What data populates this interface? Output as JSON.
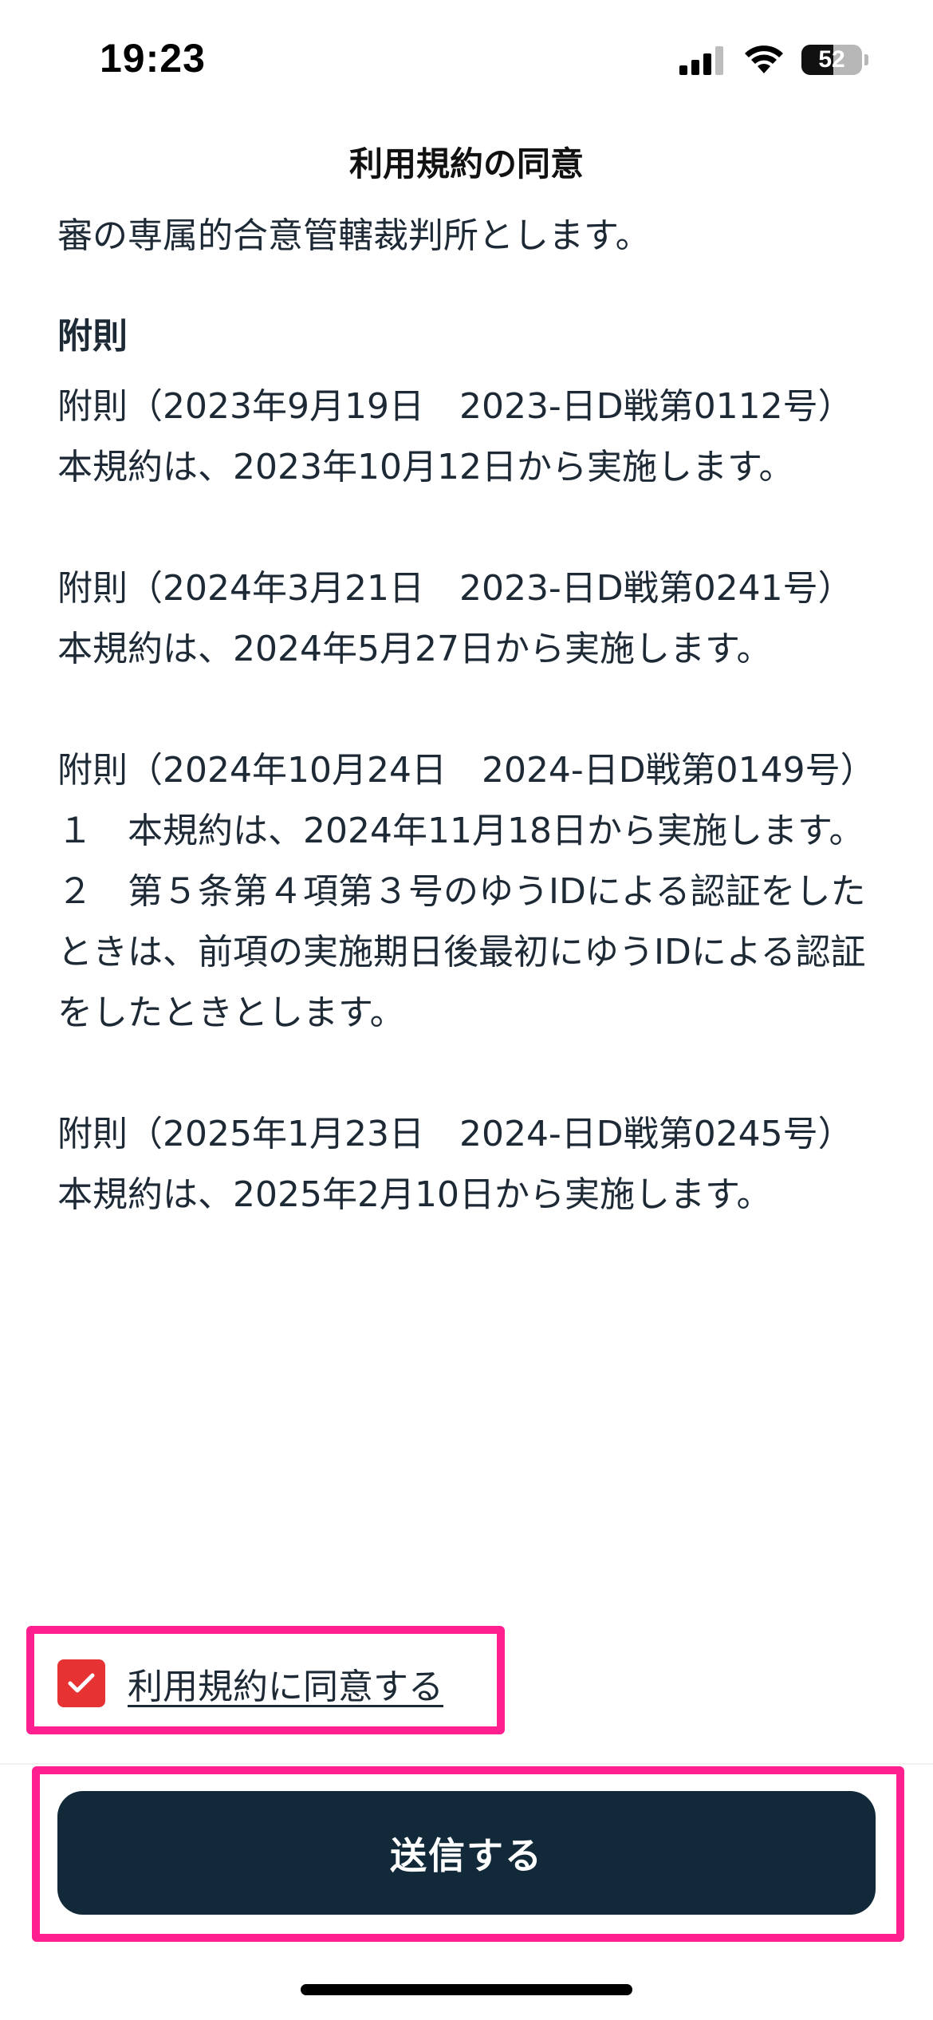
{
  "status_bar": {
    "time": "19:23",
    "battery_level": "52",
    "battery_fraction": 0.52,
    "signal_icon": "cellular-signal-icon",
    "wifi_icon": "wifi-icon"
  },
  "header": {
    "title": "利用規約の同意"
  },
  "terms": {
    "intro_line": "審の専属的合意管轄裁判所とします。",
    "supplementary_heading": "附則",
    "provisions": [
      {
        "heading": "附則（2023年9月19日　2023-日D戦第0112号）",
        "body": "本規約は、2023年10月12日から実施します。"
      },
      {
        "heading": "附則（2024年3月21日　2023-日D戦第0241号）",
        "body": "本規約は、2024年5月27日から実施します。"
      },
      {
        "heading": "附則（2024年10月24日　2024-日D戦第0149号）",
        "item1": "１　本規約は、2024年11月18日から実施します。",
        "item2": "２　第５条第４項第３号のゆうIDによる認証をしたときは、前項の実施期日後最初にゆうIDによる認証をしたときとします。"
      },
      {
        "heading": "附則（2025年1月23日　2024-日D戦第0245号）",
        "body": "本規約は、2025年2月10日から実施します。"
      }
    ]
  },
  "agreement": {
    "checked": true,
    "label": "利用規約に同意する",
    "check_icon": "checkmark-icon"
  },
  "footer": {
    "submit_label": "送信する"
  },
  "colors": {
    "text": "#1d2a36",
    "checkbox": "#e63232",
    "button": "#112938",
    "highlight": "#ff1f8e"
  }
}
